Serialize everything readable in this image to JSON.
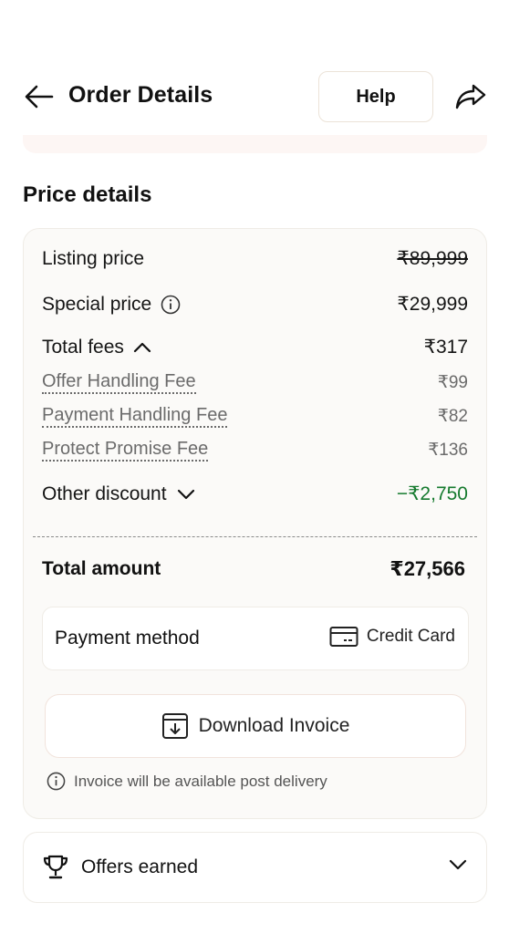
{
  "header": {
    "title": "Order Details",
    "help_label": "Help"
  },
  "price_details": {
    "section_title": "Price details",
    "listing_price": {
      "label": "Listing price",
      "value": "₹89,999"
    },
    "special_price": {
      "label": "Special price",
      "value": "₹29,999"
    },
    "total_fees": {
      "label": "Total fees",
      "value": "₹317",
      "items": [
        {
          "label": "Offer Handling Fee",
          "value": "₹99"
        },
        {
          "label": "Payment Handling Fee",
          "value": "₹82"
        },
        {
          "label": "Protect Promise Fee",
          "value": "₹136"
        }
      ]
    },
    "other_discount": {
      "label": "Other discount",
      "value": "−₹2,750"
    },
    "total_amount": {
      "label": "Total amount",
      "value": "₹27,566"
    },
    "payment": {
      "label": "Payment method",
      "value": "Credit Card"
    },
    "download_label": "Download Invoice",
    "invoice_note": "Invoice will be available post delivery"
  },
  "offers": {
    "label": "Offers earned"
  },
  "colors": {
    "discount_green": "#157a2e",
    "card_bg": "#fbfaf8",
    "border": "#efece6",
    "strip_pink": "#fdf6f4"
  },
  "icons": [
    "back-arrow-icon",
    "share-icon",
    "info-icon",
    "chevron-up-icon",
    "chevron-down-icon",
    "credit-card-icon",
    "download-icon",
    "trophy-icon"
  ]
}
